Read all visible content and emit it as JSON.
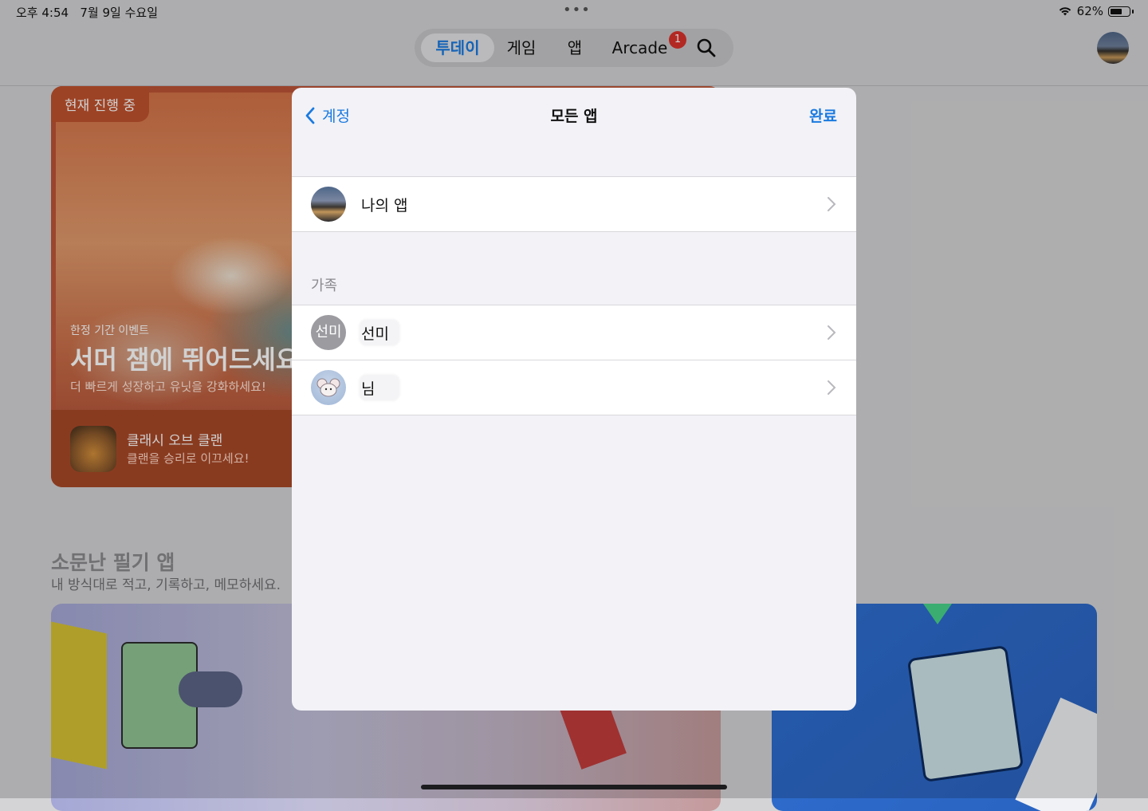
{
  "status": {
    "time": "오후 4:54",
    "date": "7월 9일 수요일",
    "battery": "62%"
  },
  "tabs": [
    {
      "label": "투데이",
      "active": true
    },
    {
      "label": "게임",
      "active": false
    },
    {
      "label": "앱",
      "active": false
    },
    {
      "label": "Arcade",
      "active": false,
      "badge": "1"
    }
  ],
  "hero": {
    "tag": "현재 진행 중",
    "subtitle": "한정 기간 이벤트",
    "title": "서머 잼에 뛰어드세요",
    "description": "더 빠르게 성장하고 유닛을 강화하세요!",
    "app_name": "클래시 오브 클랜",
    "app_tagline": "클랜을 승리로 이끄세요!"
  },
  "section": {
    "title": "소문난 필기 앱",
    "subtitle": "내 방식대로 적고, 기록하고, 메모하세요."
  },
  "sheet": {
    "back_label": "계정",
    "title": "모든 앱",
    "done_label": "완료",
    "my_apps_label": "나의 앱",
    "family_header": "가족",
    "family_members": [
      {
        "avatar_text": "선미",
        "name": "선미"
      },
      {
        "avatar_text": "",
        "name": "님"
      }
    ]
  },
  "colors": {
    "accent": "#1a7ae0",
    "badge": "#d9332c",
    "hero": "#bb5134"
  }
}
